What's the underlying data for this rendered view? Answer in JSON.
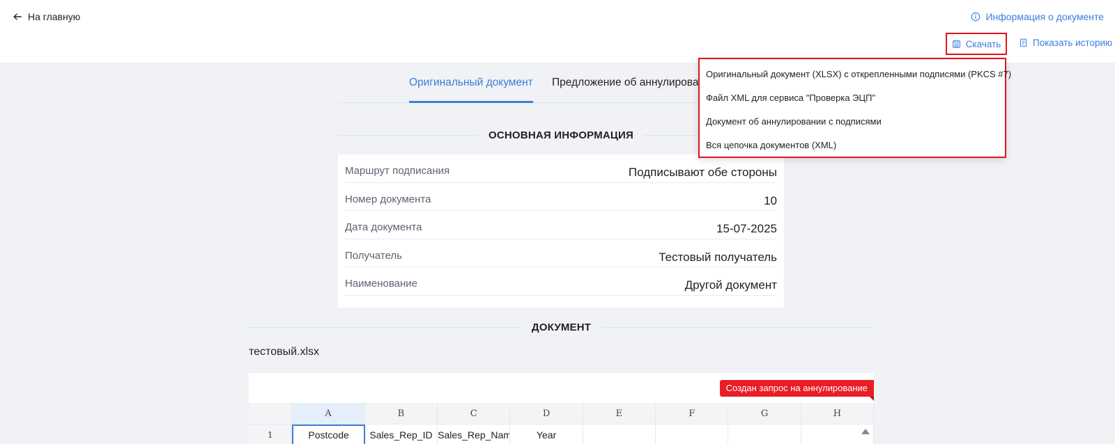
{
  "header": {
    "back_label": "На главную",
    "doc_info_label": "Информация о документе",
    "download_label": "Скачать",
    "history_label": "Показать историю"
  },
  "download_menu": {
    "items": [
      "Оригинальный документ (XLSX) с открепленными подписями (PKCS #7)",
      "Файл XML для сервиса \"Проверка ЭЦП\"",
      "Документ об аннулировании с подписями",
      "Вся цепочка документов (XML)"
    ]
  },
  "tabs": {
    "original": "Оригинальный документ",
    "cancellation": "Предложение об аннулирова"
  },
  "main_info": {
    "title": "ОСНОВНАЯ ИНФОРМАЦИЯ",
    "rows": [
      {
        "label": "Маршрут подписания",
        "value": "Подписывают обе стороны"
      },
      {
        "label": "Номер документа",
        "value": "10"
      },
      {
        "label": "Дата документа",
        "value": "15-07-2025"
      },
      {
        "label": "Получатель",
        "value": "Тестовый получатель"
      },
      {
        "label": "Наименование",
        "value": "Другой документ"
      }
    ]
  },
  "document": {
    "title": "ДОКУМЕНТ",
    "filename": "тестовый.xlsx",
    "badge": "Создан запрос на аннулирование",
    "columns": [
      "A",
      "B",
      "C",
      "D",
      "E",
      "F",
      "G",
      "H"
    ],
    "row_number": "1",
    "row_cells": [
      "Postcode",
      "Sales_Rep_ID",
      "Sales_Rep_Name",
      "Year",
      "",
      "",
      "",
      ""
    ]
  },
  "colors": {
    "accent": "#3b7ddd",
    "highlight_border": "#e0141c",
    "badge": "#e81d25",
    "page_bg": "#f0f2f5"
  }
}
